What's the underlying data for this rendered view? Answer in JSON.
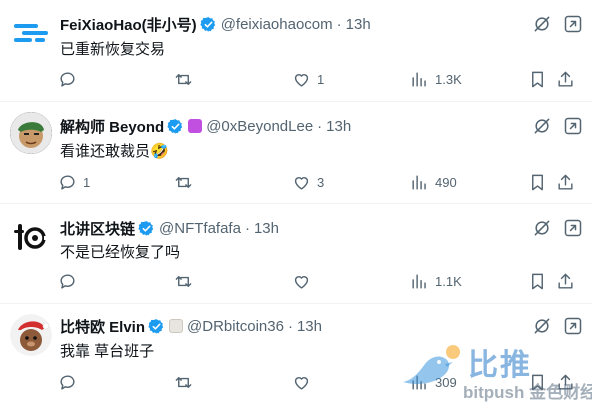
{
  "tweets": [
    {
      "name": "FeiXiaoHao(非小号)",
      "handle": "@feixiaohaocom",
      "time": "13h",
      "text": "已重新恢复交易",
      "reply_count": "",
      "retweet_count": "",
      "like_count": "1",
      "view_count": "1.3K"
    },
    {
      "name": "解构师 Beyond",
      "handle": "@0xBeyondLee",
      "time": "13h",
      "text": "看谁还敢裁员🤣",
      "reply_count": "1",
      "retweet_count": "",
      "like_count": "3",
      "view_count": "490"
    },
    {
      "name": "北讲区块链",
      "handle": "@NFTfafafa",
      "time": "13h",
      "text": "不是已经恢复了吗",
      "reply_count": "",
      "retweet_count": "",
      "like_count": "",
      "view_count": "1.1K"
    },
    {
      "name": "比特欧 Elvin",
      "handle": "@DRbitcoin36",
      "time": "13h",
      "text": "我靠 草台班子",
      "reply_count": "",
      "retweet_count": "",
      "like_count": "",
      "view_count": "309"
    }
  ],
  "watermark": {
    "title": "比推",
    "subtitle": "bitpush 金色财经"
  },
  "colors": {
    "verified": "#1d9bf0",
    "icon_gray": "#536471",
    "text": "#0f1419",
    "divider": "#eff3f4"
  },
  "icons": [
    "verified-badge-icon",
    "grok-icon",
    "more-icon",
    "reply-icon",
    "retweet-icon",
    "like-icon",
    "views-icon",
    "bookmark-icon",
    "share-icon"
  ]
}
